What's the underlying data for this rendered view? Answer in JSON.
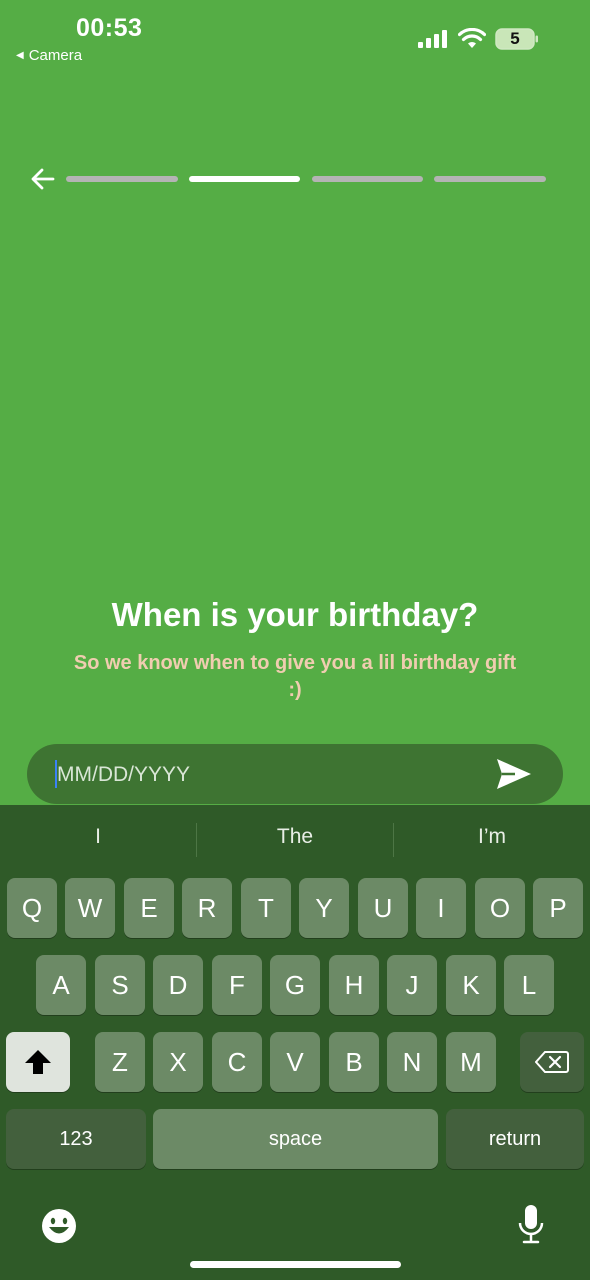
{
  "status_bar": {
    "time": "00:53",
    "back_app": "Camera",
    "battery": "5"
  },
  "progress": {
    "steps": 4,
    "current_step": 2
  },
  "question": {
    "title": "When is your birthday?",
    "subtitle": "So we know when to give you a lil birthday gift :)"
  },
  "input": {
    "placeholder": "MM/DD/YYYY",
    "value": ""
  },
  "keyboard": {
    "suggestions": [
      "I",
      "The",
      "I’m"
    ],
    "row1": [
      "Q",
      "W",
      "E",
      "R",
      "T",
      "Y",
      "U",
      "I",
      "O",
      "P"
    ],
    "row2": [
      "A",
      "S",
      "D",
      "F",
      "G",
      "H",
      "J",
      "K",
      "L"
    ],
    "row3": [
      "Z",
      "X",
      "C",
      "V",
      "B",
      "N",
      "M"
    ],
    "numbers_label": "123",
    "space_label": "space",
    "return_label": "return"
  },
  "colors": {
    "background": "#55ad45",
    "subtitle": "#f0cdb0",
    "keyboard": "#2f5a28"
  }
}
